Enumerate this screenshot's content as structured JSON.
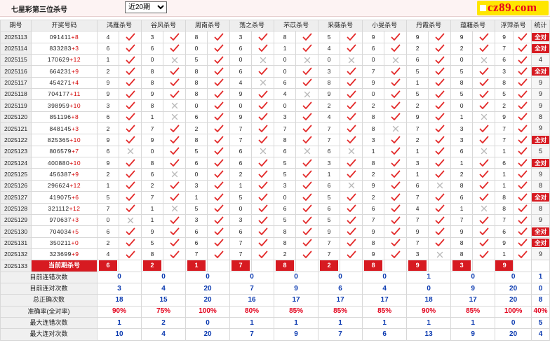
{
  "header": {
    "title": "七星彩第三位杀号",
    "range_selected": "近20期",
    "logo_text": "cz89.com"
  },
  "columns": [
    "期号",
    "开奖号码",
    "鸿雁杀号",
    "谷风杀号",
    "周南杀号",
    "荡之杀号",
    "芣苡杀号",
    "采薇杀号",
    "小旻杀号",
    "丹霞杀号",
    "蕴藉杀号",
    "浮萍杀号",
    "统计"
  ],
  "rows": [
    {
      "period": "2025113",
      "draw": "091411",
      "sum": "+8",
      "k": [
        [
          4,
          1
        ],
        [
          3,
          1
        ],
        [
          8,
          1
        ],
        [
          3,
          1
        ],
        [
          8,
          1
        ],
        [
          5,
          1
        ],
        [
          9,
          1
        ],
        [
          9,
          1
        ],
        [
          9,
          1
        ],
        [
          9,
          1
        ]
      ],
      "total": "全对"
    },
    {
      "period": "2025114",
      "draw": "833283",
      "sum": "+3",
      "k": [
        [
          6,
          1
        ],
        [
          6,
          1
        ],
        [
          0,
          1
        ],
        [
          6,
          1
        ],
        [
          1,
          1
        ],
        [
          4,
          1
        ],
        [
          6,
          1
        ],
        [
          2,
          1
        ],
        [
          2,
          1
        ],
        [
          7,
          1
        ]
      ],
      "total": "全对"
    },
    {
      "period": "2025115",
      "draw": "170629",
      "sum": "+12",
      "k": [
        [
          1,
          1
        ],
        [
          0,
          0
        ],
        [
          5,
          1
        ],
        [
          0,
          0
        ],
        [
          0,
          0
        ],
        [
          0,
          0
        ],
        [
          0,
          0
        ],
        [
          6,
          1
        ],
        [
          0,
          0
        ],
        [
          6,
          1
        ]
      ],
      "total": "4"
    },
    {
      "period": "2025116",
      "draw": "664231",
      "sum": "+9",
      "k": [
        [
          2,
          1
        ],
        [
          8,
          1
        ],
        [
          8,
          1
        ],
        [
          6,
          1
        ],
        [
          0,
          1
        ],
        [
          3,
          1
        ],
        [
          7,
          1
        ],
        [
          5,
          1
        ],
        [
          5,
          1
        ],
        [
          3,
          1
        ]
      ],
      "total": "全对"
    },
    {
      "period": "2025117",
      "draw": "454271",
      "sum": "+4",
      "k": [
        [
          9,
          1
        ],
        [
          8,
          1
        ],
        [
          8,
          1
        ],
        [
          4,
          0
        ],
        [
          6,
          1
        ],
        [
          8,
          1
        ],
        [
          9,
          1
        ],
        [
          1,
          1
        ],
        [
          8,
          1
        ],
        [
          8,
          1
        ]
      ],
      "total": "9"
    },
    {
      "period": "2025118",
      "draw": "704177",
      "sum": "+11",
      "k": [
        [
          9,
          1
        ],
        [
          9,
          1
        ],
        [
          8,
          1
        ],
        [
          9,
          1
        ],
        [
          4,
          0
        ],
        [
          9,
          1
        ],
        [
          0,
          1
        ],
        [
          5,
          1
        ],
        [
          5,
          1
        ],
        [
          5,
          1
        ]
      ],
      "total": "9"
    },
    {
      "period": "2025119",
      "draw": "398959",
      "sum": "+10",
      "k": [
        [
          3,
          1
        ],
        [
          8,
          0
        ],
        [
          0,
          1
        ],
        [
          0,
          1
        ],
        [
          0,
          1
        ],
        [
          2,
          1
        ],
        [
          2,
          1
        ],
        [
          2,
          1
        ],
        [
          0,
          1
        ],
        [
          2,
          1
        ]
      ],
      "total": "9"
    },
    {
      "period": "2025120",
      "draw": "851196",
      "sum": "+8",
      "k": [
        [
          6,
          1
        ],
        [
          1,
          0
        ],
        [
          6,
          1
        ],
        [
          9,
          1
        ],
        [
          3,
          1
        ],
        [
          4,
          1
        ],
        [
          8,
          1
        ],
        [
          9,
          1
        ],
        [
          1,
          0
        ],
        [
          9,
          1
        ]
      ],
      "total": "8"
    },
    {
      "period": "2025121",
      "draw": "848145",
      "sum": "+3",
      "k": [
        [
          2,
          1
        ],
        [
          7,
          1
        ],
        [
          2,
          1
        ],
        [
          7,
          1
        ],
        [
          7,
          1
        ],
        [
          7,
          1
        ],
        [
          8,
          0
        ],
        [
          7,
          1
        ],
        [
          3,
          1
        ],
        [
          7,
          1
        ]
      ],
      "total": "9"
    },
    {
      "period": "2025122",
      "draw": "825365",
      "sum": "+10",
      "k": [
        [
          9,
          1
        ],
        [
          9,
          1
        ],
        [
          8,
          1
        ],
        [
          7,
          1
        ],
        [
          8,
          1
        ],
        [
          7,
          1
        ],
        [
          3,
          1
        ],
        [
          2,
          1
        ],
        [
          3,
          1
        ],
        [
          7,
          1
        ]
      ],
      "total": "全对"
    },
    {
      "period": "2025123",
      "draw": "806579",
      "sum": "+7",
      "k": [
        [
          6,
          0
        ],
        [
          0,
          1
        ],
        [
          5,
          1
        ],
        [
          6,
          0
        ],
        [
          6,
          0
        ],
        [
          6,
          0
        ],
        [
          1,
          1
        ],
        [
          1,
          1
        ],
        [
          6,
          0
        ],
        [
          1,
          1
        ]
      ],
      "total": "5"
    },
    {
      "period": "2025124",
      "draw": "400880",
      "sum": "+10",
      "k": [
        [
          9,
          1
        ],
        [
          8,
          1
        ],
        [
          6,
          1
        ],
        [
          6,
          1
        ],
        [
          5,
          1
        ],
        [
          3,
          1
        ],
        [
          8,
          1
        ],
        [
          3,
          1
        ],
        [
          1,
          1
        ],
        [
          6,
          1
        ]
      ],
      "total": "全对"
    },
    {
      "period": "2025125",
      "draw": "456387",
      "sum": "+9",
      "k": [
        [
          2,
          1
        ],
        [
          6,
          0
        ],
        [
          0,
          1
        ],
        [
          2,
          1
        ],
        [
          5,
          1
        ],
        [
          1,
          1
        ],
        [
          2,
          1
        ],
        [
          1,
          1
        ],
        [
          2,
          1
        ],
        [
          1,
          1
        ]
      ],
      "total": "9"
    },
    {
      "period": "2025126",
      "draw": "296624",
      "sum": "+12",
      "k": [
        [
          1,
          1
        ],
        [
          2,
          1
        ],
        [
          3,
          1
        ],
        [
          1,
          1
        ],
        [
          3,
          1
        ],
        [
          6,
          0
        ],
        [
          9,
          1
        ],
        [
          6,
          0
        ],
        [
          8,
          1
        ],
        [
          1,
          1
        ]
      ],
      "total": "8"
    },
    {
      "period": "2025127",
      "draw": "419075",
      "sum": "+6",
      "k": [
        [
          5,
          1
        ],
        [
          7,
          1
        ],
        [
          1,
          1
        ],
        [
          5,
          1
        ],
        [
          0,
          1
        ],
        [
          5,
          1
        ],
        [
          2,
          1
        ],
        [
          7,
          1
        ],
        [
          6,
          1
        ],
        [
          8,
          1
        ]
      ],
      "total": "全对"
    },
    {
      "period": "2025128",
      "draw": "321112",
      "sum": "+12",
      "k": [
        [
          7,
          1
        ],
        [
          1,
          0
        ],
        [
          5,
          1
        ],
        [
          0,
          1
        ],
        [
          6,
          1
        ],
        [
          6,
          1
        ],
        [
          6,
          1
        ],
        [
          4,
          1
        ],
        [
          1,
          0
        ],
        [
          8,
          1
        ]
      ],
      "total": "8"
    },
    {
      "period": "2025129",
      "draw": "970637",
      "sum": "+3",
      "k": [
        [
          0,
          0
        ],
        [
          1,
          1
        ],
        [
          3,
          1
        ],
        [
          3,
          1
        ],
        [
          5,
          1
        ],
        [
          5,
          1
        ],
        [
          7,
          1
        ],
        [
          7,
          1
        ],
        [
          7,
          1
        ],
        [
          7,
          1
        ]
      ],
      "total": "9"
    },
    {
      "period": "2025130",
      "draw": "704034",
      "sum": "+5",
      "k": [
        [
          6,
          1
        ],
        [
          9,
          1
        ],
        [
          6,
          1
        ],
        [
          6,
          1
        ],
        [
          8,
          1
        ],
        [
          9,
          1
        ],
        [
          9,
          1
        ],
        [
          9,
          1
        ],
        [
          9,
          1
        ],
        [
          6,
          1
        ]
      ],
      "total": "全对"
    },
    {
      "period": "2025131",
      "draw": "350211",
      "sum": "+0",
      "k": [
        [
          2,
          1
        ],
        [
          5,
          1
        ],
        [
          6,
          1
        ],
        [
          7,
          1
        ],
        [
          8,
          1
        ],
        [
          7,
          1
        ],
        [
          8,
          1
        ],
        [
          7,
          1
        ],
        [
          8,
          1
        ],
        [
          9,
          1
        ]
      ],
      "total": "全对"
    },
    {
      "period": "2025132",
      "draw": "323699",
      "sum": "+9",
      "k": [
        [
          4,
          1
        ],
        [
          8,
          1
        ],
        [
          7,
          1
        ],
        [
          7,
          1
        ],
        [
          2,
          1
        ],
        [
          7,
          1
        ],
        [
          9,
          1
        ],
        [
          3,
          0
        ],
        [
          8,
          1
        ],
        [
          1,
          1
        ]
      ],
      "total": "9"
    }
  ],
  "current": {
    "period": "2025133",
    "label": "当前期杀号",
    "kills": [
      "6",
      "2",
      "1",
      "7",
      "8",
      "2",
      "8",
      "9",
      "3",
      "9"
    ]
  },
  "stats": [
    {
      "label": "目前连错次数",
      "values": [
        "0",
        "0",
        "0",
        "0",
        "0",
        "0",
        "0",
        "1",
        "0",
        "0",
        "1"
      ],
      "pct": false
    },
    {
      "label": "目前连对次数",
      "values": [
        "3",
        "4",
        "20",
        "7",
        "9",
        "6",
        "4",
        "0",
        "9",
        "20",
        "0"
      ],
      "pct": false
    },
    {
      "label": "总正确次数",
      "values": [
        "18",
        "15",
        "20",
        "16",
        "17",
        "17",
        "17",
        "18",
        "17",
        "20",
        "8"
      ],
      "pct": false
    },
    {
      "label": "准确率(全对率)",
      "values": [
        "90%",
        "75%",
        "100%",
        "80%",
        "85%",
        "85%",
        "85%",
        "90%",
        "85%",
        "100%",
        "40%"
      ],
      "pct": true
    },
    {
      "label": "最大连错次数",
      "values": [
        "1",
        "2",
        "0",
        "1",
        "1",
        "1",
        "1",
        "1",
        "1",
        "0",
        "5"
      ],
      "pct": false
    },
    {
      "label": "最大连对次数",
      "values": [
        "10",
        "4",
        "20",
        "7",
        "9",
        "7",
        "6",
        "13",
        "9",
        "20",
        "4"
      ],
      "pct": false
    }
  ],
  "colors": {
    "accent_red": "#d71a21",
    "check_red": "#e32a2a",
    "cross_gray": "#b9b9b9",
    "stat_blue": "#0b3ab0",
    "logo_yellow": "#ffe600"
  }
}
